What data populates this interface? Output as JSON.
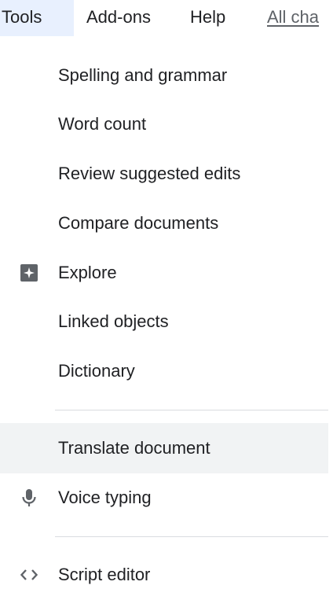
{
  "menubar": {
    "items": [
      {
        "label": "Tools"
      },
      {
        "label": "Add-ons"
      },
      {
        "label": "Help"
      }
    ],
    "changes_link": "All cha"
  },
  "menu": {
    "items": [
      {
        "label": "Spelling and grammar"
      },
      {
        "label": "Word count"
      },
      {
        "label": "Review suggested edits"
      },
      {
        "label": "Compare documents"
      },
      {
        "label": "Explore",
        "icon": "explore-icon"
      },
      {
        "label": "Linked objects"
      },
      {
        "label": "Dictionary"
      },
      {
        "label": "Translate document"
      },
      {
        "label": "Voice typing",
        "icon": "microphone-icon"
      },
      {
        "label": "Script editor",
        "icon": "code-brackets-icon"
      }
    ]
  },
  "colors": {
    "active_menu_bg": "#e8f0fe",
    "hover_item_bg": "#f1f3f4",
    "icon": "#5f6368",
    "text": "#202124",
    "divider": "#dadce0"
  }
}
